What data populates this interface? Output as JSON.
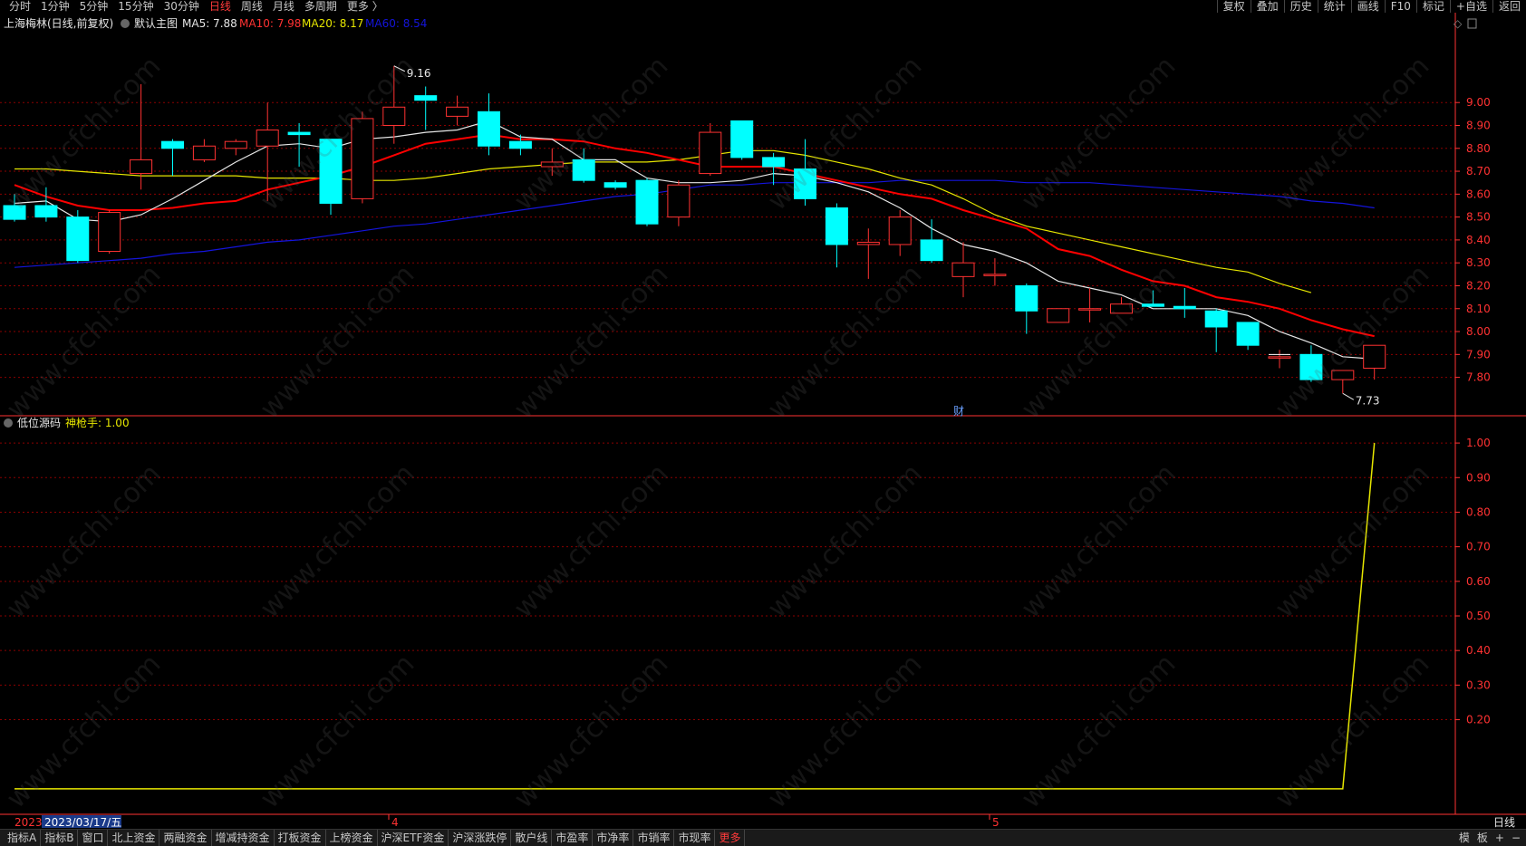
{
  "topbar": {
    "periods": [
      "分时",
      "1分钟",
      "5分钟",
      "15分钟",
      "30分钟",
      "日线",
      "周线",
      "月线",
      "多周期",
      "更多 〉"
    ],
    "active_period": "日线",
    "right_buttons": [
      "复权",
      "叠加",
      "历史",
      "统计",
      "画线",
      "F10",
      "标记",
      "+自选",
      "返回"
    ]
  },
  "main_legend": {
    "name": "上海梅林(日线,前复权)",
    "template": "默认主图",
    "ma5_label": "MA5: 7.88",
    "ma10_label": "MA10: 7.98",
    "ma20_label": "MA20: 8.17",
    "ma60_label": "MA60: 8.54"
  },
  "sub_legend": {
    "name": "低位源码",
    "indicator_label": "神枪手: 1.00"
  },
  "annotations": {
    "high": "9.16",
    "low": "7.73",
    "cai": "财"
  },
  "date_axis": {
    "selected": "2023/03/17/五",
    "clipped_year": "2023",
    "month_4": "4",
    "month_5": "5",
    "right_label": "日线"
  },
  "watermark": "www.cfchi.com",
  "bottombar": {
    "tabs": [
      "指标A",
      "指标B",
      "窗口",
      "北上资金",
      "两融资金",
      "增减持资金",
      "打板资金",
      "上榜资金",
      "沪深ETF资金",
      "沪深涨跌停",
      "散户线",
      "市盈率",
      "市净率",
      "市销率",
      "市现率",
      "更多"
    ],
    "controls": [
      "模",
      "板",
      "+",
      "−"
    ]
  },
  "colors": {
    "up": "#ff3232",
    "down": "#00ffff",
    "ma5": "#e6e6e6",
    "ma10": "#ff0000",
    "ma20": "#e6e600",
    "ma60": "#1414dc",
    "grid": "#8b0000",
    "axis": "#ff3232",
    "signal": "#e6e600"
  },
  "chart_data": [
    {
      "type": "candlestick",
      "title": "上海梅林(日线,前复权)",
      "y_ticks": [
        7.8,
        7.9,
        8.0,
        8.1,
        8.2,
        8.3,
        8.4,
        8.5,
        8.6,
        8.7,
        8.8,
        8.9,
        9.0
      ],
      "y_tick_labels": [
        "7.80",
        "7.90",
        "8.00",
        "8.10",
        "8.20",
        "8.30",
        "8.40",
        "8.50",
        "8.60",
        "8.70",
        "8.80",
        "8.90",
        "9.00"
      ],
      "ylim": [
        7.66,
        9.25
      ],
      "candles": [
        {
          "o": 8.55,
          "h": 8.6,
          "l": 8.48,
          "c": 8.49
        },
        {
          "o": 8.55,
          "h": 8.63,
          "l": 8.48,
          "c": 8.5
        },
        {
          "o": 8.5,
          "h": 8.53,
          "l": 8.3,
          "c": 8.31
        },
        {
          "o": 8.35,
          "h": 8.53,
          "l": 8.34,
          "c": 8.52
        },
        {
          "o": 8.69,
          "h": 9.08,
          "l": 8.62,
          "c": 8.75
        },
        {
          "o": 8.83,
          "h": 8.84,
          "l": 8.68,
          "c": 8.8
        },
        {
          "o": 8.75,
          "h": 8.84,
          "l": 8.74,
          "c": 8.81
        },
        {
          "o": 8.8,
          "h": 8.84,
          "l": 8.77,
          "c": 8.83
        },
        {
          "o": 8.81,
          "h": 9.0,
          "l": 8.57,
          "c": 8.88
        },
        {
          "o": 8.87,
          "h": 8.91,
          "l": 8.72,
          "c": 8.86
        },
        {
          "o": 8.84,
          "h": 8.84,
          "l": 8.51,
          "c": 8.56
        },
        {
          "o": 8.58,
          "h": 8.96,
          "l": 8.56,
          "c": 8.93
        },
        {
          "o": 8.9,
          "h": 9.16,
          "l": 8.82,
          "c": 8.98
        },
        {
          "o": 9.03,
          "h": 9.07,
          "l": 8.88,
          "c": 9.01
        },
        {
          "o": 8.94,
          "h": 9.03,
          "l": 8.9,
          "c": 8.98
        },
        {
          "o": 8.96,
          "h": 9.04,
          "l": 8.77,
          "c": 8.81
        },
        {
          "o": 8.83,
          "h": 8.86,
          "l": 8.77,
          "c": 8.8
        },
        {
          "o": 8.72,
          "h": 8.8,
          "l": 8.68,
          "c": 8.74
        },
        {
          "o": 8.75,
          "h": 8.8,
          "l": 8.65,
          "c": 8.66
        },
        {
          "o": 8.65,
          "h": 8.66,
          "l": 8.62,
          "c": 8.63
        },
        {
          "o": 8.66,
          "h": 8.67,
          "l": 8.46,
          "c": 8.47
        },
        {
          "o": 8.5,
          "h": 8.66,
          "l": 8.46,
          "c": 8.64
        },
        {
          "o": 8.69,
          "h": 8.91,
          "l": 8.68,
          "c": 8.87
        },
        {
          "o": 8.92,
          "h": 8.92,
          "l": 8.75,
          "c": 8.76
        },
        {
          "o": 8.76,
          "h": 8.78,
          "l": 8.64,
          "c": 8.72
        },
        {
          "o": 8.71,
          "h": 8.84,
          "l": 8.55,
          "c": 8.58
        },
        {
          "o": 8.54,
          "h": 8.56,
          "l": 8.28,
          "c": 8.38
        },
        {
          "o": 8.38,
          "h": 8.45,
          "l": 8.23,
          "c": 8.39
        },
        {
          "o": 8.38,
          "h": 8.53,
          "l": 8.33,
          "c": 8.5
        },
        {
          "o": 8.4,
          "h": 8.49,
          "l": 8.3,
          "c": 8.31
        },
        {
          "o": 8.24,
          "h": 8.39,
          "l": 8.15,
          "c": 8.3
        },
        {
          "o": 8.25,
          "h": 8.32,
          "l": 8.2,
          "c": 8.25
        },
        {
          "o": 8.2,
          "h": 8.21,
          "l": 7.99,
          "c": 8.09
        },
        {
          "o": 8.04,
          "h": 8.1,
          "l": 8.04,
          "c": 8.1
        },
        {
          "o": 8.1,
          "h": 8.19,
          "l": 8.04,
          "c": 8.1
        },
        {
          "o": 8.08,
          "h": 8.15,
          "l": 8.08,
          "c": 8.12
        },
        {
          "o": 8.12,
          "h": 8.18,
          "l": 8.11,
          "c": 8.11
        },
        {
          "o": 8.11,
          "h": 8.19,
          "l": 8.06,
          "c": 8.1
        },
        {
          "o": 8.09,
          "h": 8.1,
          "l": 7.91,
          "c": 8.02
        },
        {
          "o": 8.04,
          "h": 8.04,
          "l": 7.92,
          "c": 7.94
        },
        {
          "o": 7.89,
          "h": 7.92,
          "l": 7.84,
          "c": 7.89
        },
        {
          "o": 7.9,
          "h": 7.94,
          "l": 7.78,
          "c": 7.79
        },
        {
          "o": 7.79,
          "h": 7.83,
          "l": 7.73,
          "c": 7.83
        },
        {
          "o": 7.84,
          "h": 7.94,
          "l": 7.79,
          "c": 7.94
        }
      ],
      "ma5": [
        8.56,
        8.57,
        8.49,
        8.48,
        8.51,
        8.58,
        8.66,
        8.74,
        8.81,
        8.82,
        8.8,
        8.84,
        8.85,
        8.87,
        8.88,
        8.92,
        8.85,
        8.84,
        8.75,
        8.75,
        8.67,
        8.65,
        8.65,
        8.66,
        8.69,
        8.68,
        8.65,
        8.61,
        8.54,
        8.45,
        8.38,
        8.35,
        8.3,
        8.22,
        8.19,
        8.16,
        8.1,
        8.1,
        8.1,
        8.07,
        8.0,
        7.95,
        7.89,
        7.88
      ],
      "ma10": [
        8.64,
        8.59,
        8.55,
        8.53,
        8.53,
        8.54,
        8.56,
        8.57,
        8.62,
        8.65,
        8.68,
        8.72,
        8.77,
        8.82,
        8.84,
        8.86,
        8.84,
        8.84,
        8.83,
        8.8,
        8.78,
        8.75,
        8.72,
        8.72,
        8.72,
        8.69,
        8.66,
        8.63,
        8.6,
        8.58,
        8.53,
        8.49,
        8.45,
        8.36,
        8.33,
        8.27,
        8.22,
        8.2,
        8.15,
        8.13,
        8.1,
        8.05,
        8.01,
        7.98
      ],
      "ma20": [
        8.71,
        8.71,
        8.7,
        8.69,
        8.68,
        8.68,
        8.68,
        8.68,
        8.67,
        8.67,
        8.67,
        8.66,
        8.66,
        8.67,
        8.69,
        8.71,
        8.72,
        8.73,
        8.74,
        8.74,
        8.74,
        8.75,
        8.77,
        8.79,
        8.79,
        8.77,
        8.74,
        8.71,
        8.67,
        8.64,
        8.58,
        8.51,
        8.46,
        8.43,
        8.4,
        8.37,
        8.34,
        8.31,
        8.28,
        8.26,
        8.21,
        8.17
      ],
      "ma20_start_index": 0,
      "ma60": [
        8.28,
        8.29,
        8.3,
        8.31,
        8.32,
        8.34,
        8.35,
        8.37,
        8.39,
        8.4,
        8.42,
        8.44,
        8.46,
        8.47,
        8.49,
        8.51,
        8.53,
        8.55,
        8.57,
        8.59,
        8.6,
        8.62,
        8.64,
        8.64,
        8.65,
        8.65,
        8.65,
        8.65,
        8.66,
        8.66,
        8.66,
        8.66,
        8.65,
        8.65,
        8.65,
        8.64,
        8.63,
        8.62,
        8.61,
        8.6,
        8.59,
        8.57,
        8.56,
        8.54
      ],
      "high_marker": {
        "index": 12,
        "value": 9.16
      },
      "low_marker": {
        "index": 42,
        "value": 7.73
      }
    },
    {
      "type": "line",
      "title": "低位源码",
      "series": [
        {
          "name": "神枪手",
          "values": [
            0,
            0,
            0,
            0,
            0,
            0,
            0,
            0,
            0,
            0,
            0,
            0,
            0,
            0,
            0,
            0,
            0,
            0,
            0,
            0,
            0,
            0,
            0,
            0,
            0,
            0,
            0,
            0,
            0,
            0,
            0,
            0,
            0,
            0,
            0,
            0,
            0,
            0,
            0,
            0,
            0,
            0,
            0,
            1.0
          ]
        }
      ],
      "y_ticks": [
        0.2,
        0.3,
        0.4,
        0.5,
        0.6,
        0.7,
        0.8,
        0.9,
        1.0
      ],
      "y_tick_labels": [
        "0.20",
        "0.30",
        "0.40",
        "0.50",
        "0.60",
        "0.70",
        "0.80",
        "0.90",
        "1.00"
      ],
      "ylim": [
        -0.05,
        1.05
      ]
    }
  ]
}
